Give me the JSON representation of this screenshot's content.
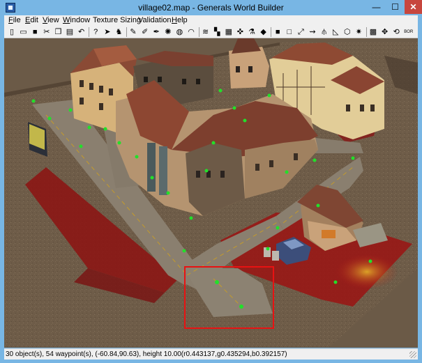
{
  "window": {
    "title": "village02.map - Generals World Builder",
    "controls": {
      "minimize": "—",
      "maximize": "☐",
      "close": "✕"
    }
  },
  "menu": {
    "items": [
      {
        "label": "File",
        "accel": "F"
      },
      {
        "label": "Edit",
        "accel": "E"
      },
      {
        "label": "View",
        "accel": "V"
      },
      {
        "label": "Window",
        "accel": "W"
      },
      {
        "label": "Texture Sizing",
        "accel": ""
      },
      {
        "label": "Validation",
        "accel": ""
      },
      {
        "label": "Help",
        "accel": "H"
      }
    ]
  },
  "toolbar": {
    "tools": [
      {
        "name": "new-file-icon",
        "glyph": "▯"
      },
      {
        "name": "open-folder-icon",
        "glyph": "▭"
      },
      {
        "name": "save-icon",
        "glyph": "■"
      },
      {
        "name": "cut-icon",
        "glyph": "✂"
      },
      {
        "name": "copy-icon",
        "glyph": "❐"
      },
      {
        "name": "paste-icon",
        "glyph": "▤"
      },
      {
        "name": "undo-icon",
        "glyph": "↶"
      },
      {
        "name": "help-pointer-icon",
        "glyph": "?"
      },
      {
        "name": "select-arrow-icon",
        "glyph": "➤"
      },
      {
        "name": "object-place-icon",
        "glyph": "♞"
      },
      {
        "name": "brush-icon",
        "glyph": "✎"
      },
      {
        "name": "brush-alt-icon",
        "glyph": "✐"
      },
      {
        "name": "feather-brush-icon",
        "glyph": "✒"
      },
      {
        "name": "smooth-icon",
        "glyph": "✺"
      },
      {
        "name": "texture-blend-icon",
        "glyph": "◍"
      },
      {
        "name": "height-map-icon",
        "glyph": "◠"
      },
      {
        "name": "water-icon",
        "glyph": "≋"
      },
      {
        "name": "checker-tile-icon",
        "glyph": "▚"
      },
      {
        "name": "tile-fill-icon",
        "glyph": "▦"
      },
      {
        "name": "pick-tile-icon",
        "glyph": "✜"
      },
      {
        "name": "eyedropper-icon",
        "glyph": "⚗"
      },
      {
        "name": "paint-bucket-icon",
        "glyph": "◆"
      },
      {
        "name": "square-solid-icon",
        "glyph": "■"
      },
      {
        "name": "square-outline-icon",
        "glyph": "□"
      },
      {
        "name": "road-tool-icon",
        "glyph": "⤢"
      },
      {
        "name": "waypoint-path-icon",
        "glyph": "⇝"
      },
      {
        "name": "fence-icon",
        "glyph": "⫛"
      },
      {
        "name": "ramp-icon",
        "glyph": "◺"
      },
      {
        "name": "area-tool-icon",
        "glyph": "⬡"
      },
      {
        "name": "scorch-icon",
        "glyph": "✷"
      },
      {
        "name": "grid-icon",
        "glyph": "▩"
      },
      {
        "name": "move-tool-icon",
        "glyph": "✥"
      },
      {
        "name": "rotate-tool-icon",
        "glyph": "⟲"
      },
      {
        "name": "border-tool-icon",
        "glyph": "BOR"
      }
    ]
  },
  "status": {
    "text": "30 object(s), 54 waypoint(s), (-60.84,90.63), height 10.00(r0.443137,g0.435294,b0.392157)"
  },
  "colors": {
    "titlebar": "#78b6e4",
    "ground": "#6e5c48",
    "road": "#8a7f6f",
    "red_zone": "#9b1313",
    "waypoint": "#22e02a",
    "selection_box": "#e81212",
    "roof": "#8a4a35"
  }
}
